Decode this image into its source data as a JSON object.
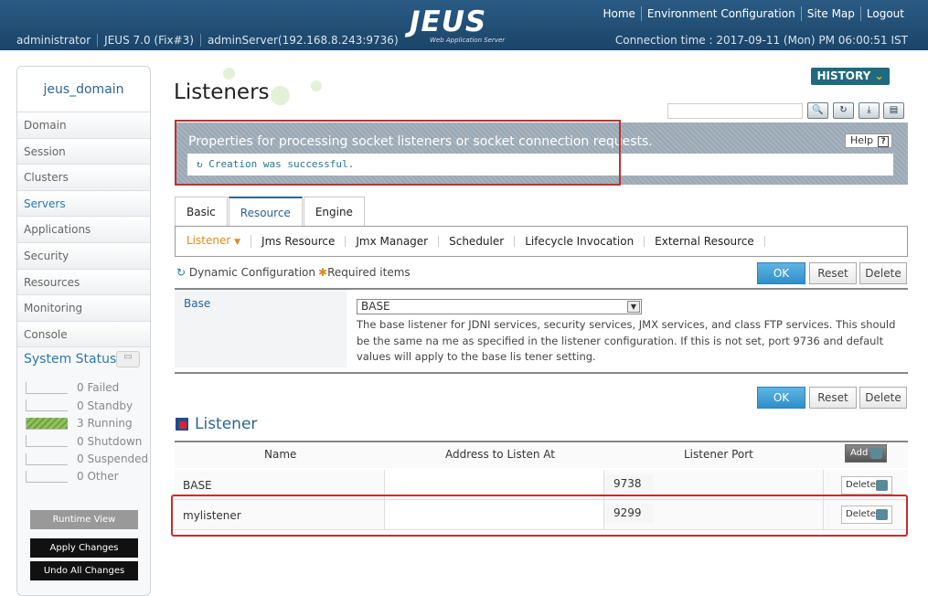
{
  "header": {
    "logo": "JEUS",
    "logo_sub": "Web Application Server",
    "nav": [
      "Home",
      "Environment Configuration",
      "Site Map",
      "Logout"
    ],
    "user": "administrator",
    "version": "JEUS 7.0 (Fix#3)",
    "server": "adminServer(192.168.8.243:9736)",
    "connection": "Connection time : 2017-09-11 (Mon) PM 06:00:51 IST"
  },
  "sidebar": {
    "domain": "jeus_domain",
    "items": [
      "Domain",
      "Session",
      "Clusters",
      "Servers",
      "Applications",
      "Security",
      "Resources",
      "Monitoring",
      "Console"
    ],
    "active": "Servers",
    "system_status_title": "System Status",
    "status": [
      {
        "count": "0",
        "label": "Failed"
      },
      {
        "count": "0",
        "label": "Standby"
      },
      {
        "count": "3",
        "label": "Running"
      },
      {
        "count": "0",
        "label": "Shutdown"
      },
      {
        "count": "0",
        "label": "Suspended"
      },
      {
        "count": "0",
        "label": "Other"
      }
    ],
    "runtime_view": "Runtime View",
    "apply_changes": "Apply Changes",
    "undo_changes": "Undo All Changes"
  },
  "page": {
    "title": "Listeners",
    "history": "HISTORY",
    "info_text": "Properties for processing socket listeners or socket connection requests.",
    "help": "Help",
    "success": "Creation was successful.",
    "tabs": [
      "Basic",
      "Resource",
      "Engine"
    ],
    "active_tab": "Resource",
    "subtabs": [
      "Listener",
      "Jms Resource",
      "Jmx Manager",
      "Scheduler",
      "Lifecycle Invocation",
      "External Resource"
    ],
    "dynamic_config": "Dynamic Configuration",
    "required_items": "Required items",
    "ok": "OK",
    "reset": "Reset",
    "delete": "Delete",
    "base_label": "Base",
    "base_value": "BASE",
    "base_desc": "The base listener for JDNI services, security services, JMX services, and class FTP services. This should be the same na me as specified in the listener configuration. If this is not set, port 9736 and default values will apply to the base lis tener setting.",
    "section_title": "Listener",
    "add": "Add",
    "columns": [
      "Name",
      "Address to Listen At",
      "Listener Port"
    ],
    "rows": [
      {
        "name": "BASE",
        "address": "",
        "port": "9738",
        "action": "Delete"
      },
      {
        "name": "mylistener",
        "address": "",
        "port": "9299",
        "action": "Delete"
      }
    ]
  }
}
